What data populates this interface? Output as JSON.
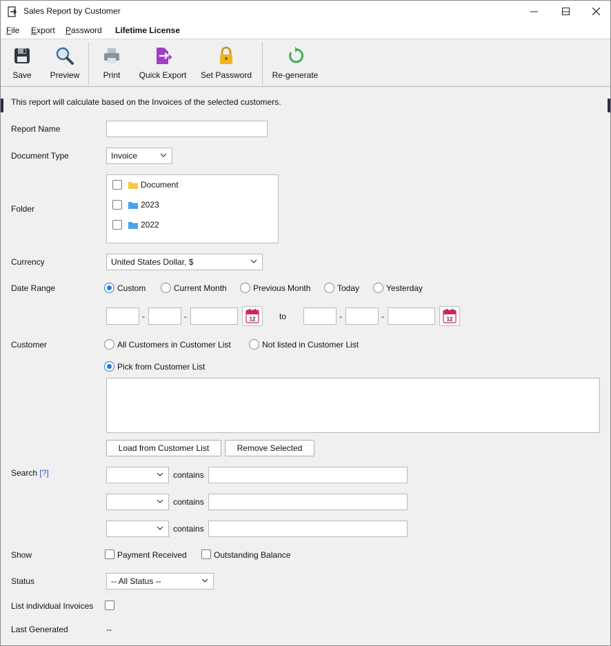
{
  "window": {
    "title": "Sales Report by Customer"
  },
  "menu": [
    {
      "label": "File",
      "mnemonic": "F",
      "rest": "ile"
    },
    {
      "label": "Export",
      "mnemonic": "E",
      "rest": "xport"
    },
    {
      "label": "Password",
      "mnemonic": "P",
      "rest": "assword"
    },
    {
      "label": "Lifetime License"
    }
  ],
  "toolbar": {
    "save": "Save",
    "preview": "Preview",
    "print": "Print",
    "quick_export": "Quick Export",
    "set_password": "Set Password",
    "regenerate": "Re-generate"
  },
  "form": {
    "intro": "This report will calculate based on the Invoices of the selected customers.",
    "report_name_label": "Report Name",
    "report_name_value": "",
    "document_type_label": "Document Type",
    "document_type_value": "Invoice",
    "folder_label": "Folder",
    "folders": [
      {
        "name": "Document",
        "checked": false,
        "color": "#f5c842"
      },
      {
        "name": "2023",
        "checked": false,
        "color": "#4aa3e8"
      },
      {
        "name": "2022",
        "checked": false,
        "color": "#4aa3e8"
      }
    ],
    "currency_label": "Currency",
    "currency_value": "United States Dollar, $",
    "date_range_label": "Date Range",
    "date_options": [
      "Custom",
      "Current Month",
      "Previous Month",
      "Today",
      "Yesterday"
    ],
    "date_selected": "Custom",
    "date_sep": "-",
    "date_to": "to",
    "calendar_day": "12",
    "customer_label": "Customer",
    "customer_options": [
      "All Customers in Customer List",
      "Not listed in Customer List",
      "Pick from Customer List"
    ],
    "customer_selected": "Pick from Customer List",
    "load_button": "Load from Customer List",
    "remove_button": "Remove Selected",
    "search_label": "Search",
    "search_help": "[?]",
    "search_rows": [
      {
        "field": "",
        "op": "contains",
        "value": ""
      },
      {
        "field": "",
        "op": "contains",
        "value": ""
      },
      {
        "field": "",
        "op": "contains",
        "value": ""
      }
    ],
    "show_label": "Show",
    "show_payment": "Payment Received",
    "show_outstanding": "Outstanding Balance",
    "status_label": "Status",
    "status_value": "-- All Status --",
    "list_individual_label": "List individual Invoices",
    "last_generated_label": "Last Generated",
    "last_generated_value": "--"
  },
  "colors": {
    "accent": "#2a7ad6",
    "save_icon": "#2f3a45",
    "quick_export_icon": "#a23cc8",
    "lock_icon": "#f0b41c",
    "regen_icon": "#3fae5a",
    "calendar_icon": "#d6245a"
  }
}
